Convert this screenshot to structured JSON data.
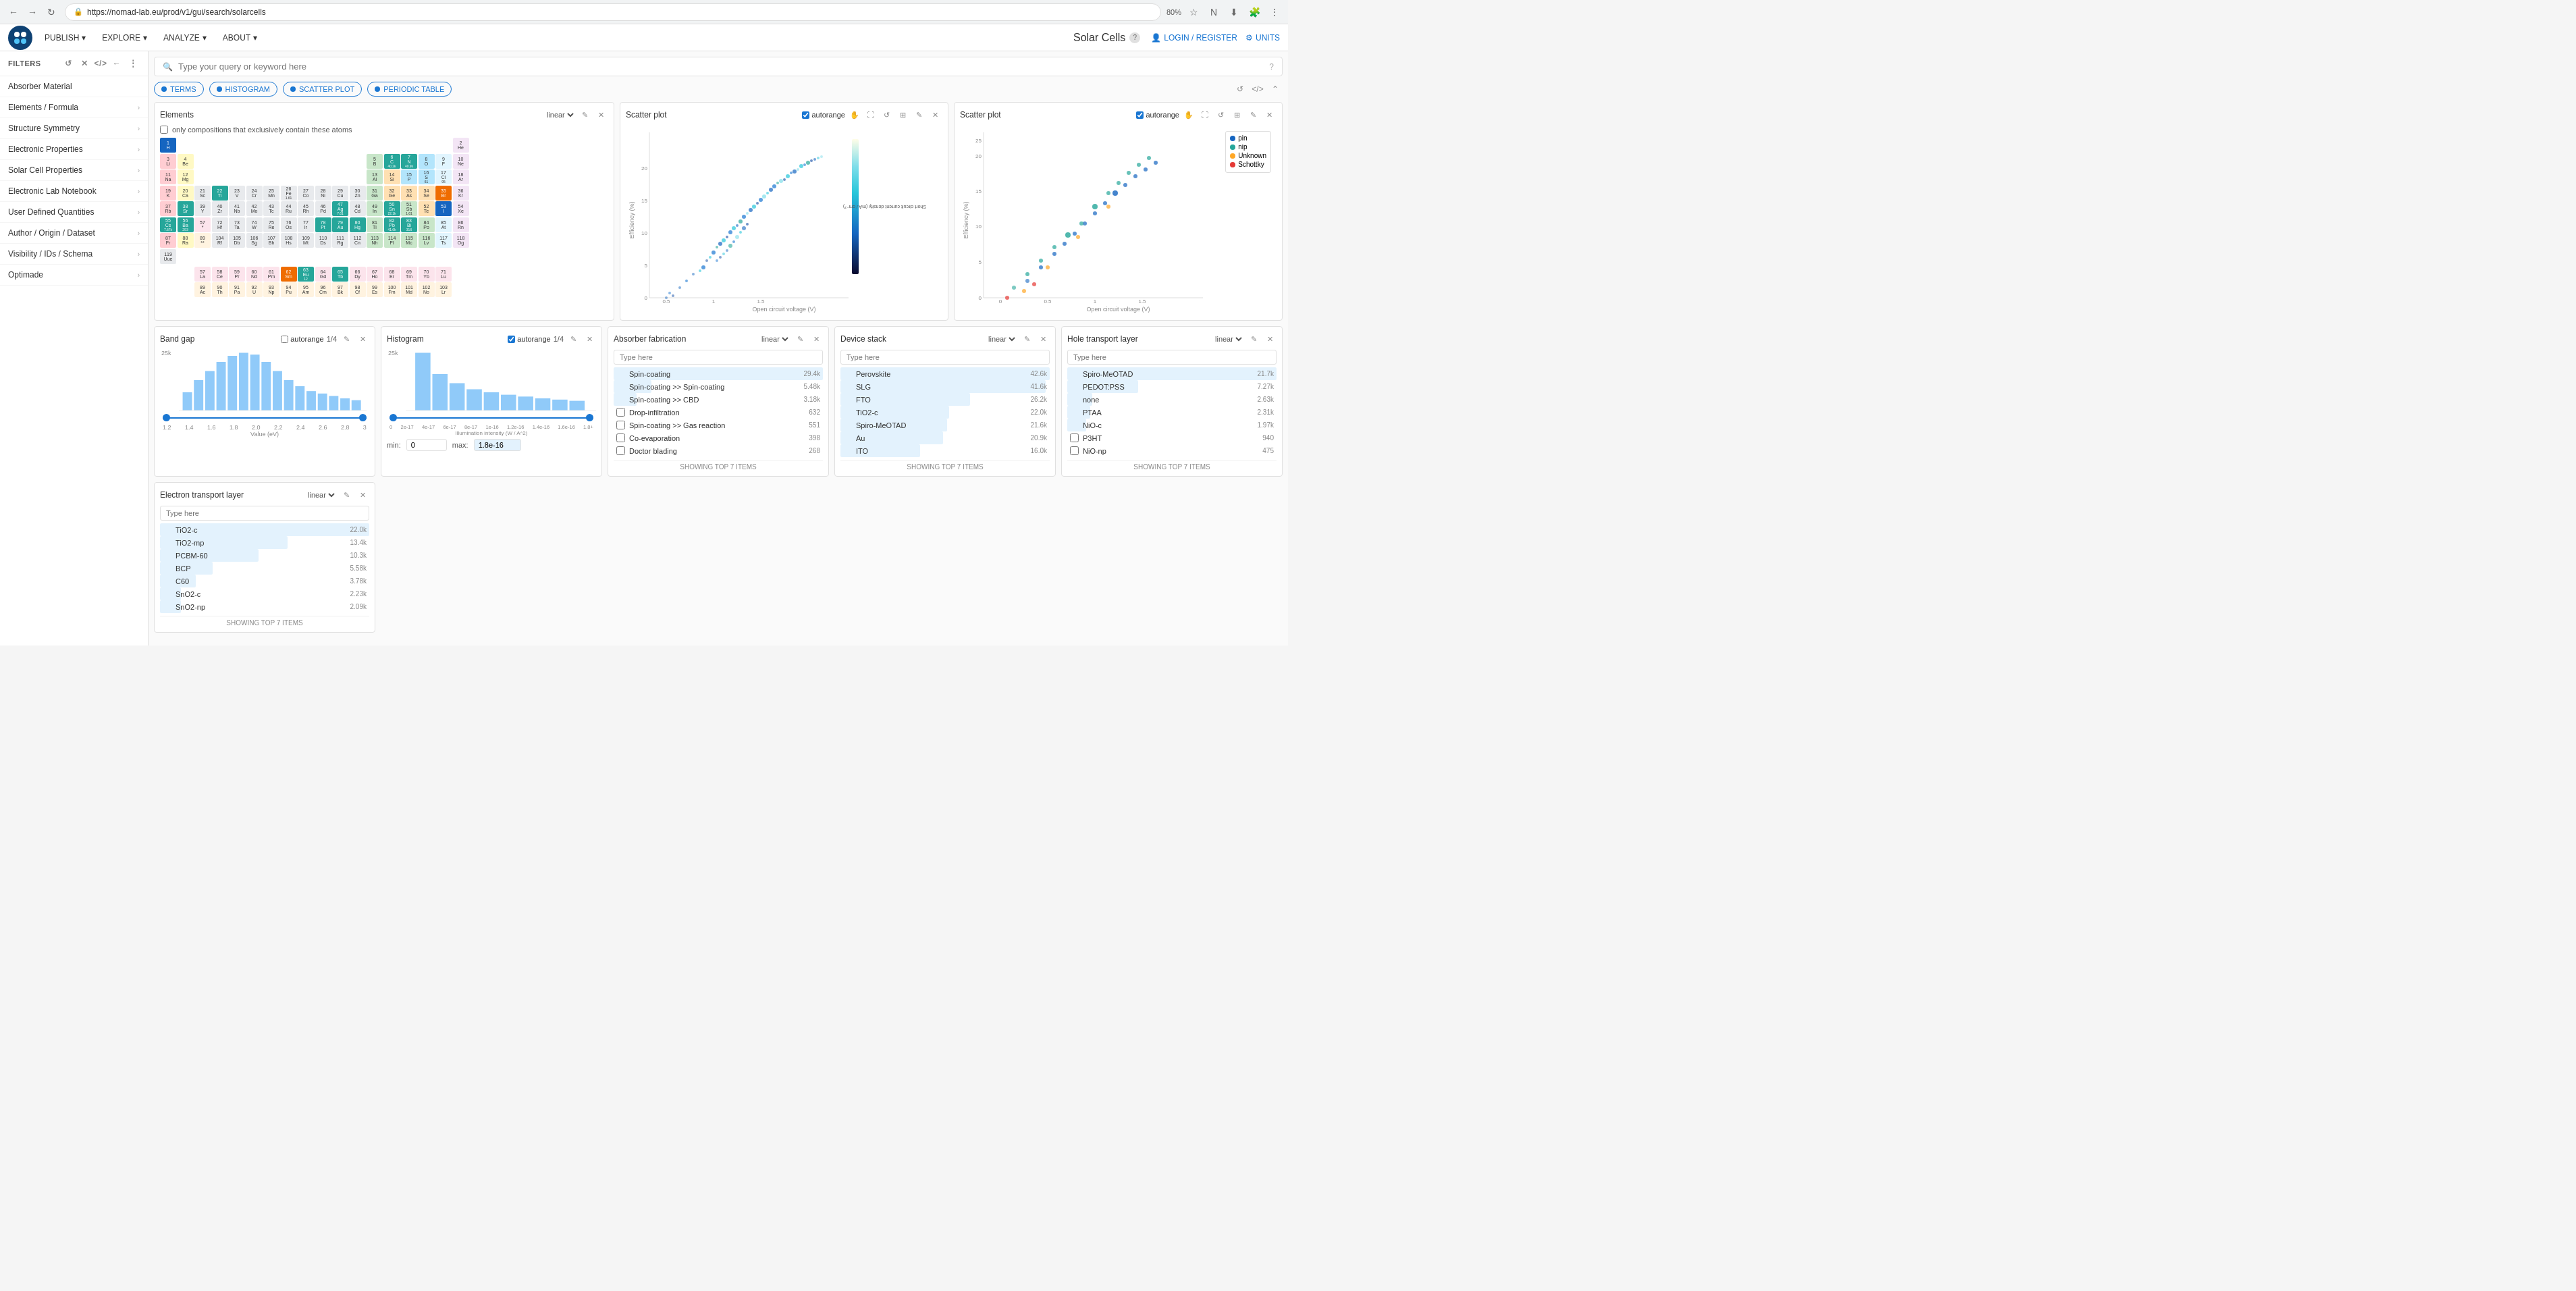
{
  "browser": {
    "url": "https://nomad-lab.eu/prod/v1/gui/search/solarcells",
    "zoom": "80%"
  },
  "nav": {
    "publish": "PUBLISH",
    "explore": "EXPLORE",
    "analyze": "ANALYZE",
    "about": "ABOUT",
    "app_title": "Solar Cells",
    "login": "LOGIN / REGISTER",
    "units": "UNITS"
  },
  "filters_header": "FILTERS",
  "sidebar_items": [
    {
      "id": "absorber-material",
      "label": "Absorber Material"
    },
    {
      "id": "elements-formula",
      "label": "Elements / Formula"
    },
    {
      "id": "structure-symmetry",
      "label": "Structure Symmetry"
    },
    {
      "id": "electronic-properties",
      "label": "Electronic Properties"
    },
    {
      "id": "solar-cell-properties",
      "label": "Solar Cell Properties"
    },
    {
      "id": "electronic-lab-notebook",
      "label": "Electronic Lab Notebook"
    },
    {
      "id": "user-defined-quantities",
      "label": "User Defined Quantities"
    },
    {
      "id": "author-origin-dataset",
      "label": "Author / Origin / Dataset"
    },
    {
      "id": "visibility-ids-schema",
      "label": "Visibility / IDs / Schema"
    },
    {
      "id": "optimade",
      "label": "Optimade"
    }
  ],
  "search_placeholder": "Type your query or keyword here",
  "tabs": [
    "TERMS",
    "HISTOGRAM",
    "SCATTER PLOT",
    "PERIODIC TABLE"
  ],
  "elements_widget": {
    "title": "Elements",
    "scale": "linear",
    "checkbox_label": "only compositions that exclusively contain these atoms"
  },
  "scatter_plot_1": {
    "title": "Scatter plot",
    "autorange": true,
    "x_axis": "Open circuit voltage (V)",
    "y_axis": "Efficiency (%)",
    "colorbar_label": "Short circuit current density (mA / cm^2)"
  },
  "scatter_plot_2": {
    "title": "Scatter plot",
    "autorange": true,
    "x_axis": "Open circuit voltage (V)",
    "y_axis": "Efficiency (%)",
    "legend": [
      {
        "label": "pin",
        "color": "#1565c0"
      },
      {
        "label": "nip",
        "color": "#26a69a"
      },
      {
        "label": "Unknown",
        "color": "#ffa726"
      },
      {
        "label": "Schottky",
        "color": "#e53935"
      }
    ]
  },
  "band_gap": {
    "title": "Band gap",
    "autorange": false,
    "fraction": "1/4",
    "y_max": "25k",
    "x_min": "1.2",
    "x_max": "3",
    "x_label": "Value (eV)",
    "ticks": [
      "1.2",
      "1.4",
      "1.6",
      "1.8",
      "2.0",
      "2.2",
      "2.4",
      "2.6",
      "2.8",
      "3"
    ]
  },
  "histogram": {
    "title": "Histogram",
    "autorange": true,
    "fraction": "1/4",
    "y_max": "25k",
    "x_label": "Illumination intensity (W / A^2)",
    "min_value": "0",
    "max_value": "1.8e-16",
    "ticks": [
      "0",
      "2e-17",
      "4e-17",
      "6e-17",
      "8e-17",
      "1e-16",
      "1.2e-16",
      "1.4e-16",
      "1.6e-16",
      "1.8+"
    ]
  },
  "absorber_fabrication": {
    "title": "Absorber fabrication",
    "scale": "linear",
    "search_placeholder": "Type here",
    "items": [
      {
        "label": "Spin-coating",
        "count": "29.4k",
        "bar": 100
      },
      {
        "label": "Spin-coating >> Spin-coating",
        "count": "5.48k",
        "bar": 18
      },
      {
        "label": "Spin-coating >> CBD",
        "count": "3.18k",
        "bar": 11
      },
      {
        "label": "Drop-infiltration",
        "count": "632",
        "bar": 2
      },
      {
        "label": "Spin-coating >> Gas reaction",
        "count": "551",
        "bar": 2
      },
      {
        "label": "Co-evaporation",
        "count": "398",
        "bar": 1
      },
      {
        "label": "Doctor blading",
        "count": "268",
        "bar": 1
      }
    ],
    "footer": "SHOWING TOP 7 ITEMS"
  },
  "device_stack": {
    "title": "Device stack",
    "scale": "linear",
    "search_placeholder": "Type here",
    "items": [
      {
        "label": "Perovskite",
        "count": "42.6k",
        "bar": 100
      },
      {
        "label": "SLG",
        "count": "41.6k",
        "bar": 98
      },
      {
        "label": "FTO",
        "count": "26.2k",
        "bar": 62
      },
      {
        "label": "TiO2-c",
        "count": "22.0k",
        "bar": 52
      },
      {
        "label": "Spiro-MeOTAD",
        "count": "21.6k",
        "bar": 51
      },
      {
        "label": "Au",
        "count": "20.9k",
        "bar": 49
      },
      {
        "label": "ITO",
        "count": "16.0k",
        "bar": 38
      }
    ],
    "footer": "SHOWING TOP 7 ITEMS"
  },
  "hole_transport": {
    "title": "Hole transport layer",
    "scale": "linear",
    "search_placeholder": "Type here",
    "items": [
      {
        "label": "Spiro-MeOTAD",
        "count": "21.7k",
        "bar": 100
      },
      {
        "label": "PEDOT:PSS",
        "count": "7.27k",
        "bar": 34
      },
      {
        "label": "none",
        "count": "2.63k",
        "bar": 12
      },
      {
        "label": "PTAA",
        "count": "2.31k",
        "bar": 11
      },
      {
        "label": "NiO-c",
        "count": "1.97k",
        "bar": 9
      },
      {
        "label": "P3HT",
        "count": "940",
        "bar": 4
      },
      {
        "label": "NiO-np",
        "count": "475",
        "bar": 2
      }
    ],
    "footer": "SHOWING TOP 7 ITEMS"
  },
  "electron_transport": {
    "title": "Electron transport layer",
    "scale": "linear",
    "search_placeholder": "Type here",
    "items": [
      {
        "label": "TiO2-c",
        "count": "22.0k",
        "bar": 100
      },
      {
        "label": "TiO2-mp",
        "count": "13.4k",
        "bar": 61
      },
      {
        "label": "PCBM-60",
        "count": "10.3k",
        "bar": 47
      },
      {
        "label": "BCP",
        "count": "5.58k",
        "bar": 25
      },
      {
        "label": "C60",
        "count": "3.78k",
        "bar": 17
      },
      {
        "label": "SnO2-c",
        "count": "2.23k",
        "bar": 10
      },
      {
        "label": "SnO2-np",
        "count": "2.09k",
        "bar": 10
      }
    ],
    "footer": "SHOWING TOP 7 ITEMS"
  }
}
